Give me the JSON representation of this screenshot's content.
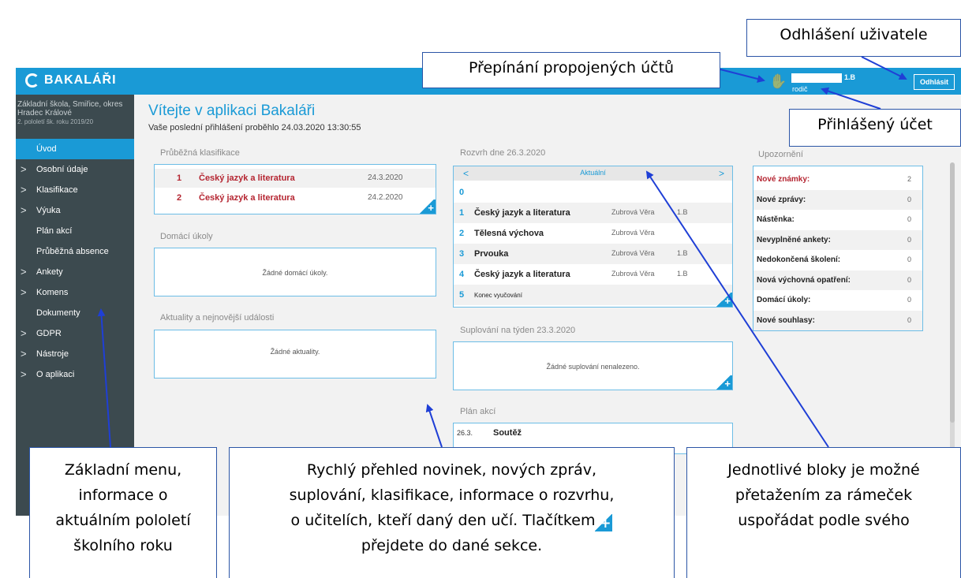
{
  "app": {
    "logo_text": "BAKALÁŘI",
    "user_class": "1.B",
    "user_role": "rodič",
    "logout_label": "Odhlásit"
  },
  "sidebar": {
    "school_line1": "Základní škola, Smiřice, okres",
    "school_line2": "Hradec Králové",
    "term": "2. pololetí šk. roku 2019/20",
    "items": [
      {
        "label": "Úvod",
        "chevron": false,
        "active": true
      },
      {
        "label": "Osobní údaje",
        "chevron": true
      },
      {
        "label": "Klasifikace",
        "chevron": true
      },
      {
        "label": "Výuka",
        "chevron": true
      },
      {
        "label": "Plán akcí",
        "chevron": false
      },
      {
        "label": "Průběžná absence",
        "chevron": false
      },
      {
        "label": "Ankety",
        "chevron": true
      },
      {
        "label": "Komens",
        "chevron": true
      },
      {
        "label": "Dokumenty",
        "chevron": false
      },
      {
        "label": "GDPR",
        "chevron": true
      },
      {
        "label": "Nástroje",
        "chevron": true
      },
      {
        "label": "O aplikaci",
        "chevron": true
      }
    ],
    "chevron_glyph": ">"
  },
  "header": {
    "welcome": "Vítejte v aplikaci Bakaláři",
    "last_login": "Vaše poslední přihlášení proběhlo 24.03.2020 13:30:55"
  },
  "grades": {
    "title": "Průběžná klasifikace",
    "rows": [
      {
        "grade": "1",
        "subject": "Český jazyk a literatura",
        "date": "24.3.2020"
      },
      {
        "grade": "2",
        "subject": "Český jazyk a literatura",
        "date": "24.2.2020"
      }
    ]
  },
  "homework": {
    "title": "Domácí úkoly",
    "empty": "Žádné domácí úkoly."
  },
  "news": {
    "title": "Aktuality a nejnovější události",
    "empty": "Žádné aktuality."
  },
  "timetable": {
    "title": "Rozvrh dne 26.3.2020",
    "prev": "<",
    "next": ">",
    "current": "Aktuální",
    "rows": [
      {
        "num": "0",
        "subject": "",
        "teacher": "",
        "class": ""
      },
      {
        "num": "1",
        "subject": "Český jazyk a literatura",
        "teacher": "Zubrová Věra",
        "class": "1.B"
      },
      {
        "num": "2",
        "subject": "Tělesná výchova",
        "teacher": "Zubrová Věra",
        "class": ""
      },
      {
        "num": "3",
        "subject": "Prvouka",
        "teacher": "Zubrová Věra",
        "class": "1.B"
      },
      {
        "num": "4",
        "subject": "Český jazyk a literatura",
        "teacher": "Zubrová Věra",
        "class": "1.B"
      },
      {
        "num": "5",
        "subject": "Konec vyučování",
        "teacher": "",
        "class": ""
      }
    ]
  },
  "substitutions": {
    "title": "Suplování na týden 23.3.2020",
    "empty": "Žádné suplování nenalezeno."
  },
  "events": {
    "title": "Plán akcí",
    "rows": [
      {
        "date": "26.3.",
        "name": "Soutěž"
      }
    ]
  },
  "notifications": {
    "title": "Upozornění",
    "rows": [
      {
        "label": "Nové známky:",
        "value": "2",
        "highlight": true
      },
      {
        "label": "Nové zprávy:",
        "value": "0"
      },
      {
        "label": "Nástěnka:",
        "value": "0"
      },
      {
        "label": "Nevyplněné ankety:",
        "value": "0"
      },
      {
        "label": "Nedokončená školení:",
        "value": "0"
      },
      {
        "label": "Nová výchovná opatření:",
        "value": "0"
      },
      {
        "label": "Domácí úkoly:",
        "value": "0"
      },
      {
        "label": "Nové souhlasy:",
        "value": "0"
      }
    ]
  },
  "plus_glyph": "+",
  "callouts": {
    "logout": "Odhlášení uživatele",
    "switch_accounts": "Přepínání propojených účtů",
    "logged_account": "Přihlášený účet",
    "menu_line1": "Základní menu,",
    "menu_line2": "informace o",
    "menu_line3": "aktuálním pololetí",
    "menu_line4": "školního roku",
    "overview_line1": "Rychlý přehled novinek, nových zpráv,",
    "overview_line2": "suplování, klasifikace, informace o rozvrhu,",
    "overview_line3a": "o učitelích, kteří daný den učí. Tlačítkem",
    "overview_line4": "přejdete do dané sekce.",
    "blocks_line1": "Jednotlivé bloky je možné",
    "blocks_line2": "přetažením za rámeček",
    "blocks_line3": "uspořádat podle svého"
  },
  "colors": {
    "brand": "#1a9ad6",
    "sidebar": "#3c4a4f",
    "grade_red": "#b52632",
    "callout_border": "#2b55a6",
    "arrow": "#1f3fd6"
  }
}
